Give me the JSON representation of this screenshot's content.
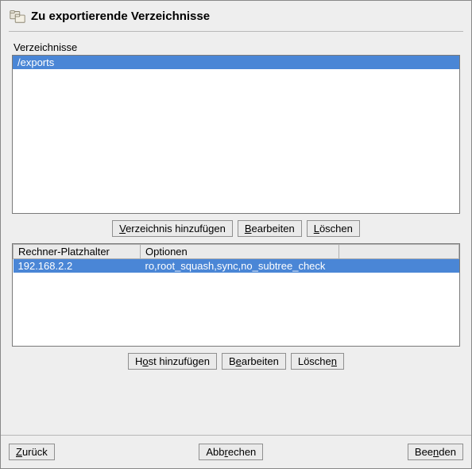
{
  "header": {
    "title": "Zu exportierende Verzeichnisse"
  },
  "directories": {
    "label": "Verzeichnisse",
    "items": [
      "/exports"
    ],
    "selected_index": 0,
    "buttons": {
      "add": {
        "pre": "",
        "u": "V",
        "post": "erzeichnis hinzufügen"
      },
      "edit": {
        "pre": "",
        "u": "B",
        "post": "earbeiten"
      },
      "delete": {
        "pre": "",
        "u": "L",
        "post": "öschen"
      }
    }
  },
  "hosts": {
    "columns": {
      "host": "Rechner-Platzhalter",
      "options": "Optionen"
    },
    "rows": [
      {
        "host": "192.168.2.2",
        "options": "ro,root_squash,sync,no_subtree_check"
      }
    ],
    "selected_index": 0,
    "buttons": {
      "add": {
        "pre": "H",
        "u": "o",
        "post": "st hinzufügen"
      },
      "edit": {
        "pre": "B",
        "u": "e",
        "post": "arbeiten"
      },
      "delete": {
        "pre": "Lösche",
        "u": "n",
        "post": ""
      }
    }
  },
  "footer": {
    "back": {
      "pre": "",
      "u": "Z",
      "post": "urück"
    },
    "cancel": {
      "pre": "Abb",
      "u": "r",
      "post": "echen"
    },
    "finish": {
      "pre": "Bee",
      "u": "n",
      "post": "den"
    }
  }
}
